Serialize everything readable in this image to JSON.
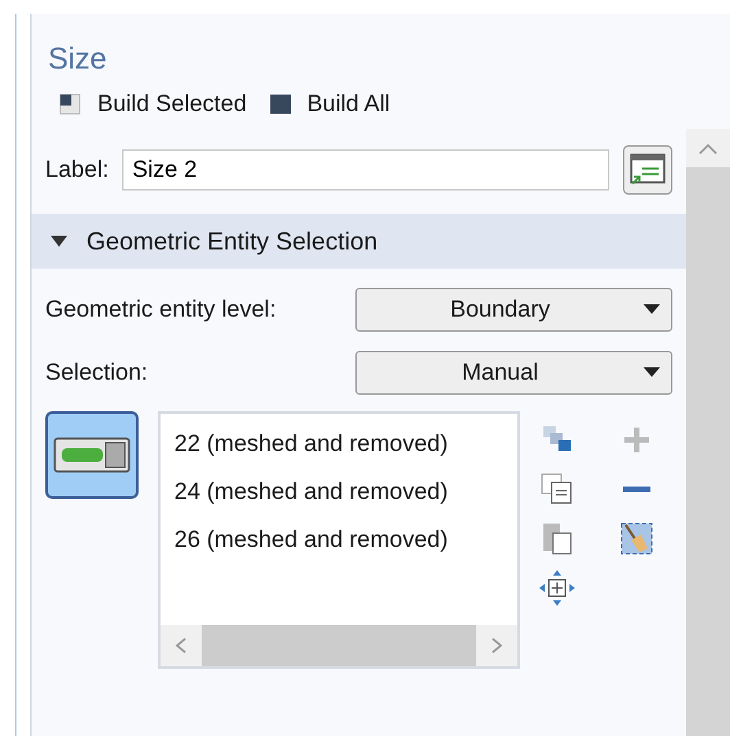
{
  "title": "Size",
  "toolbar": [
    {
      "label": "Build Selected",
      "kind": "selected"
    },
    {
      "label": "Build All",
      "kind": "all"
    }
  ],
  "label_field": {
    "label": "Label:",
    "value": "Size 2"
  },
  "section": {
    "title": "Geometric Entity Selection",
    "expanded": true
  },
  "fields": [
    {
      "label": "Geometric entity level:",
      "value": "Boundary"
    },
    {
      "label": "Selection:",
      "value": "Manual"
    }
  ],
  "active_toggle": {
    "selected": true
  },
  "selection_list": {
    "items": [
      {
        "text": "22 (meshed and removed)"
      },
      {
        "text": "24 (meshed and removed)"
      },
      {
        "text": "26 (meshed and removed)"
      }
    ]
  }
}
